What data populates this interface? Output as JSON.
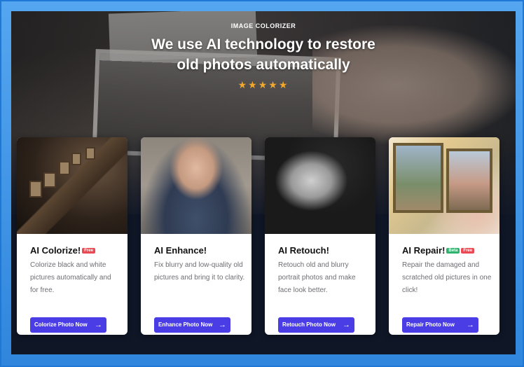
{
  "hero": {
    "eyebrow": "IMAGE COLORIZER",
    "headline_line1": "We use AI technology to restore",
    "headline_line2": "old photos automatically",
    "rating_stars": 5
  },
  "cards": [
    {
      "title": "AI Colorize!",
      "badges": [
        "Free"
      ],
      "description": "Colorize black and white pictures automatically and for free.",
      "button": "Colorize Photo Now"
    },
    {
      "title": "AI Enhance!",
      "badges": [],
      "description": "Fix blurry and low-quality old pictures and bring it to clarity.",
      "button": "Enhance Photo Now"
    },
    {
      "title": "AI Retouch!",
      "badges": [],
      "description": "Retouch old and blurry portrait photos and make face look better.",
      "button": "Retouch Photo Now"
    },
    {
      "title": "AI Repair!",
      "badges": [
        "Beta",
        "Free"
      ],
      "description": "Repair the damaged and scratched old pictures in one click!",
      "button": "Repair Photo Now"
    }
  ],
  "colors": {
    "accent": "#4a3de6",
    "badge_free": "#e94a53",
    "badge_beta": "#2fb36f",
    "star": "#f2a82c"
  },
  "icons": {
    "star": "star-icon",
    "arrow": "arrow-right-icon"
  }
}
